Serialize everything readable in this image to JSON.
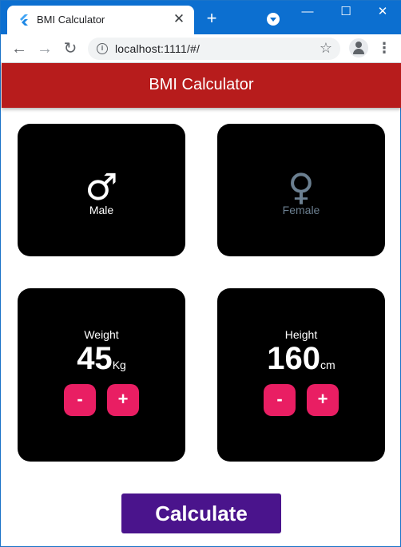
{
  "browser": {
    "tab_title": "BMI Calculator",
    "url": "localhost:1111/#/"
  },
  "app": {
    "title": "BMI Calculator"
  },
  "gender": {
    "male_label": "Male",
    "female_label": "Female",
    "male_symbol": "♂",
    "female_symbol": "♀",
    "selected": "male"
  },
  "weight": {
    "label": "Weight",
    "value": "45",
    "unit": "Kg",
    "minus": "-",
    "plus": "+"
  },
  "height": {
    "label": "Height",
    "value": "160",
    "unit": "cm",
    "minus": "-",
    "plus": "+"
  },
  "actions": {
    "calculate_label": "Calculate"
  },
  "colors": {
    "app_bar": "#b71c1c",
    "card": "#000000",
    "stepper": "#e91e63",
    "calculate": "#4a148c",
    "inactive_text": "#6b7f90"
  }
}
